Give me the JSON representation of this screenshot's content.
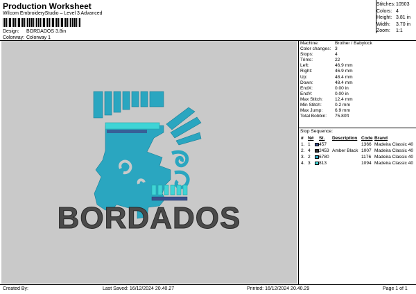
{
  "header": {
    "title": "Production Worksheet",
    "subtitle": "Wilcom EmbroideryStudio – Level 3 Advanced",
    "design_label": "Design:",
    "design_value": "BORDADOS 3.8in",
    "colorway_label": "Colorway:",
    "colorway_value": "Colorway 1"
  },
  "stats": [
    {
      "label": "Stitches:",
      "value": "10503"
    },
    {
      "label": "Colors:",
      "value": "4"
    },
    {
      "label": "Height:",
      "value": "3.81 in"
    },
    {
      "label": "Width:",
      "value": "3.70 in"
    },
    {
      "label": "Zoom:",
      "value": "1:1"
    }
  ],
  "design": {
    "text": "BORDADOS"
  },
  "machine_info": [
    {
      "label": "Machine:",
      "value": "Brother / Babylock"
    },
    {
      "label": "Color changes:",
      "value": "3"
    },
    {
      "label": "Stops:",
      "value": "4"
    },
    {
      "label": "Trims:",
      "value": "22"
    },
    {
      "label": "Left:",
      "value": "46.9 mm"
    },
    {
      "label": "Right:",
      "value": "46.9 mm"
    },
    {
      "label": "Up:",
      "value": "48.4 mm"
    },
    {
      "label": "Down:",
      "value": "48.4 mm"
    },
    {
      "label": "EndX:",
      "value": "0.00 in"
    },
    {
      "label": "EndY:",
      "value": "0.00 in"
    },
    {
      "label": "Max Stitch:",
      "value": "12.4 mm"
    },
    {
      "label": "Min Stitch:",
      "value": "0.2 mm"
    },
    {
      "label": "Max Jump:",
      "value": "6.9 mm"
    },
    {
      "label": "Total Bobbin:",
      "value": "75.80ft"
    }
  ],
  "stop_sequence": {
    "title": "Stop Sequence:",
    "headers": {
      "hash": "#",
      "n": "N#",
      "st": "St.",
      "desc": "Description",
      "code": "Code",
      "brand": "Brand"
    },
    "rows": [
      {
        "hash": "1.",
        "n": "1",
        "color": "#3b4f8c",
        "st": "457",
        "desc": "",
        "code": "1366",
        "brand": "Madeira Classic 40"
      },
      {
        "hash": "2.",
        "n": "4",
        "color": "#2e2e2e",
        "st": "2453",
        "desc": "Amber Black",
        "code": "1007",
        "brand": "Madeira Classic 40"
      },
      {
        "hash": "3.",
        "n": "2",
        "color": "#2aa6c0",
        "st": "6780",
        "desc": "",
        "code": "1176",
        "brand": "Madeira Classic 40"
      },
      {
        "hash": "4.",
        "n": "3",
        "color": "#3fd4d6",
        "st": "813",
        "desc": "",
        "code": "1094",
        "brand": "Madeira Classic 40"
      }
    ]
  },
  "footer": {
    "created_by": "Created By:",
    "last_saved": "Last Saved: 16/12/2024 20.40.27",
    "printed": "Printed: 16/12/2024 20.40.29",
    "page": "Page 1 of 1"
  }
}
